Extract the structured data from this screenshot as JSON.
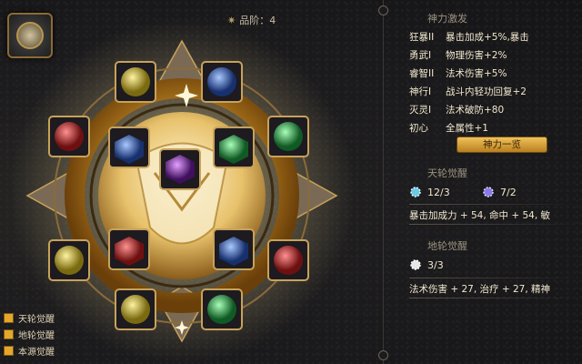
{
  "header": {
    "rank_label": "品阶：4"
  },
  "legend": [
    {
      "label": "天轮觉醒"
    },
    {
      "label": "地轮觉醒"
    },
    {
      "label": "本源觉醒"
    }
  ],
  "panel": {
    "title": "神力激发",
    "rows": [
      {
        "name": "狂暴II",
        "effect": "暴击加成+5%,暴击"
      },
      {
        "name": "勇武I",
        "effect": "物理伤害+2%"
      },
      {
        "name": "睿智II",
        "effect": "法术伤害+5%"
      },
      {
        "name": "神行I",
        "effect": "战斗内轻功回复+2"
      },
      {
        "name": "灭灵I",
        "effect": "法术破防+80"
      },
      {
        "name": "初心",
        "effect": "全属性+1"
      }
    ],
    "button_label": "神力一览",
    "sky_title": "天轮觉醒",
    "sky_stats": [
      {
        "value": "12/3"
      },
      {
        "value": "7/2"
      }
    ],
    "sky_bonus": "暴击加成力 + 54, 命中 + 54, 敏",
    "earth_title": "地轮觉醒",
    "earth_stats": [
      {
        "value": "3/3"
      }
    ],
    "earth_bonus": "法术伤害 + 27, 治疗 + 27, 精神"
  },
  "colors": {
    "gold": "#e3a82b",
    "accent_orange": "#f0c25a",
    "panel_text": "#f1e7cd"
  }
}
